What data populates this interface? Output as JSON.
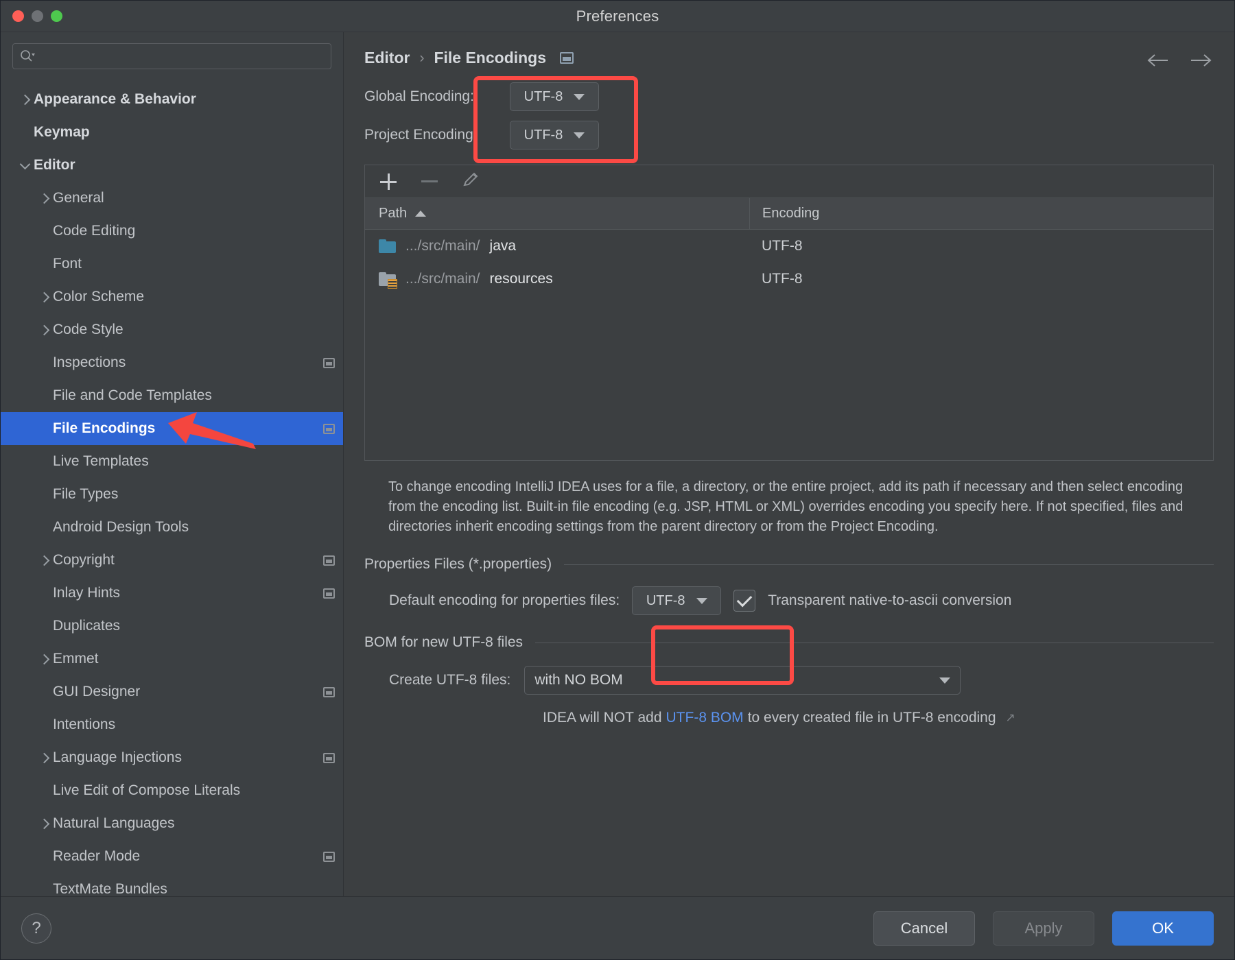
{
  "window": {
    "title": "Preferences",
    "traffic_lights": [
      "close-red",
      "minimize-yellow",
      "zoom-green"
    ]
  },
  "sidebar": {
    "search": {
      "value": "",
      "placeholder": ""
    },
    "items": [
      {
        "label": "Appearance & Behavior",
        "indent": 0,
        "arrow": "right",
        "bold": true,
        "badge": false,
        "selected": false
      },
      {
        "label": "Keymap",
        "indent": 0,
        "arrow": "none",
        "bold": true,
        "badge": false,
        "selected": false
      },
      {
        "label": "Editor",
        "indent": 0,
        "arrow": "down",
        "bold": true,
        "badge": false,
        "selected": false
      },
      {
        "label": "General",
        "indent": 1,
        "arrow": "right",
        "bold": false,
        "badge": false,
        "selected": false
      },
      {
        "label": "Code Editing",
        "indent": 1,
        "arrow": "none",
        "bold": false,
        "badge": false,
        "selected": false
      },
      {
        "label": "Font",
        "indent": 1,
        "arrow": "none",
        "bold": false,
        "badge": false,
        "selected": false
      },
      {
        "label": "Color Scheme",
        "indent": 1,
        "arrow": "right",
        "bold": false,
        "badge": false,
        "selected": false
      },
      {
        "label": "Code Style",
        "indent": 1,
        "arrow": "right",
        "bold": false,
        "badge": false,
        "selected": false
      },
      {
        "label": "Inspections",
        "indent": 1,
        "arrow": "none",
        "bold": false,
        "badge": true,
        "selected": false
      },
      {
        "label": "File and Code Templates",
        "indent": 1,
        "arrow": "none",
        "bold": false,
        "badge": false,
        "selected": false
      },
      {
        "label": "File Encodings",
        "indent": 1,
        "arrow": "none",
        "bold": true,
        "badge": true,
        "selected": true
      },
      {
        "label": "Live Templates",
        "indent": 1,
        "arrow": "none",
        "bold": false,
        "badge": false,
        "selected": false
      },
      {
        "label": "File Types",
        "indent": 1,
        "arrow": "none",
        "bold": false,
        "badge": false,
        "selected": false
      },
      {
        "label": "Android Design Tools",
        "indent": 1,
        "arrow": "none",
        "bold": false,
        "badge": false,
        "selected": false
      },
      {
        "label": "Copyright",
        "indent": 1,
        "arrow": "right",
        "bold": false,
        "badge": true,
        "selected": false
      },
      {
        "label": "Inlay Hints",
        "indent": 1,
        "arrow": "none",
        "bold": false,
        "badge": true,
        "selected": false
      },
      {
        "label": "Duplicates",
        "indent": 1,
        "arrow": "none",
        "bold": false,
        "badge": false,
        "selected": false
      },
      {
        "label": "Emmet",
        "indent": 1,
        "arrow": "right",
        "bold": false,
        "badge": false,
        "selected": false
      },
      {
        "label": "GUI Designer",
        "indent": 1,
        "arrow": "none",
        "bold": false,
        "badge": true,
        "selected": false
      },
      {
        "label": "Intentions",
        "indent": 1,
        "arrow": "none",
        "bold": false,
        "badge": false,
        "selected": false
      },
      {
        "label": "Language Injections",
        "indent": 1,
        "arrow": "right",
        "bold": false,
        "badge": true,
        "selected": false
      },
      {
        "label": "Live Edit of Compose Literals",
        "indent": 1,
        "arrow": "none",
        "bold": false,
        "badge": false,
        "selected": false
      },
      {
        "label": "Natural Languages",
        "indent": 1,
        "arrow": "right",
        "bold": false,
        "badge": false,
        "selected": false
      },
      {
        "label": "Reader Mode",
        "indent": 1,
        "arrow": "none",
        "bold": false,
        "badge": true,
        "selected": false
      },
      {
        "label": "TextMate Bundles",
        "indent": 1,
        "arrow": "none",
        "bold": false,
        "badge": false,
        "selected": false
      }
    ]
  },
  "main": {
    "breadcrumb": {
      "parent": "Editor",
      "separator": "›",
      "current": "File Encodings"
    },
    "nav": {
      "back_icon": "arrow-left-icon",
      "forward_icon": "arrow-right-icon"
    },
    "global_encoding": {
      "label": "Global Encoding:",
      "value": "UTF-8"
    },
    "project_encoding": {
      "label": "Project Encoding:",
      "value": "UTF-8"
    },
    "toolbar": {
      "add_icon": "plus-icon",
      "remove_icon": "minus-icon",
      "edit_icon": "pencil-icon"
    },
    "table": {
      "columns": [
        "Path",
        "Encoding"
      ],
      "sort_column": "Path",
      "sort_direction": "ascending",
      "rows": [
        {
          "icon": "folder-source-icon",
          "path_prefix": ".../src/main/",
          "path_name": "java",
          "encoding": "UTF-8"
        },
        {
          "icon": "folder-resources-icon",
          "path_prefix": ".../src/main/",
          "path_name": "resources",
          "encoding": "UTF-8"
        }
      ]
    },
    "description": "To change encoding IntelliJ IDEA uses for a file, a directory, or the entire project, add its path if necessary and then select encoding from the encoding list. Built-in file encoding (e.g. JSP, HTML or XML) overrides encoding you specify here. If not specified, files and directories inherit encoding settings from the parent directory or from the Project Encoding.",
    "properties_section": {
      "title": "Properties Files (*.properties)",
      "default_encoding_label": "Default encoding for properties files:",
      "default_encoding_value": "UTF-8",
      "transparent_label": "Transparent native-to-ascii conversion",
      "transparent_checked": true
    },
    "bom_section": {
      "title": "BOM for new UTF-8 files",
      "create_label": "Create UTF-8 files:",
      "create_value": "with NO BOM",
      "note_prefix": "IDEA will NOT add ",
      "note_link": "UTF-8 BOM",
      "note_suffix": " to every created file in UTF-8 encoding",
      "note_external_icon": "↗"
    }
  },
  "footer": {
    "help_label": "?",
    "cancel_label": "Cancel",
    "apply_label": "Apply",
    "ok_label": "OK"
  },
  "annotations": {
    "highlight_color": "#fc4a45",
    "arrow_target": "File Encodings",
    "boxes": [
      "encoding-dropdowns",
      "properties-default-encoding"
    ]
  }
}
